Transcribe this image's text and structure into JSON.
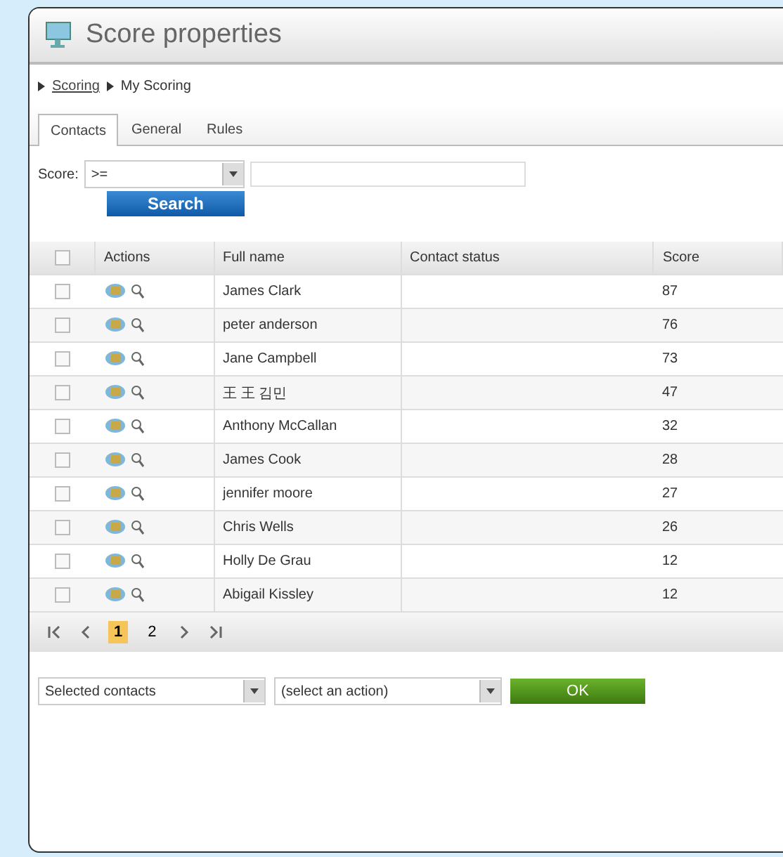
{
  "window": {
    "title": "Score properties"
  },
  "breadcrumb": [
    {
      "label": "Scoring",
      "link": true
    },
    {
      "label": "My Scoring",
      "link": false
    }
  ],
  "tabs": [
    {
      "label": "Contacts",
      "selected": true
    },
    {
      "label": "General",
      "selected": false
    },
    {
      "label": "Rules",
      "selected": false
    }
  ],
  "filter": {
    "label": "Score:",
    "operator": ">=",
    "button": "Search"
  },
  "table": {
    "select_all_checked": false,
    "columns": [
      "Actions",
      "Full name",
      "Contact status",
      "Score"
    ],
    "rows": [
      {
        "name": "James Clark",
        "score": "87",
        "checked": false
      },
      {
        "name": "peter anderson",
        "score": "76",
        "checked": false
      },
      {
        "name": "Jane Campbell",
        "score": "73",
        "checked": false
      },
      {
        "name": "王 王 김민",
        "score": "47",
        "checked": false
      },
      {
        "name": "Anthony McCallan",
        "score": "32",
        "checked": false
      },
      {
        "name": "James Cook",
        "score": "28",
        "checked": false
      },
      {
        "name": "jennifer moore",
        "score": "27",
        "checked": false
      },
      {
        "name": "Chris Wells",
        "score": "26",
        "checked": false
      },
      {
        "name": "Holly De Grau",
        "score": "12",
        "checked": false
      },
      {
        "name": "Abigail Kissley",
        "score": "12",
        "checked": false
      }
    ]
  },
  "pager": {
    "pages": [
      {
        "label": "1",
        "selected": true
      },
      {
        "label": "2",
        "selected": false
      }
    ]
  },
  "bulk": {
    "scope": "Selected contacts",
    "action": "(select an action)",
    "button": "OK"
  }
}
